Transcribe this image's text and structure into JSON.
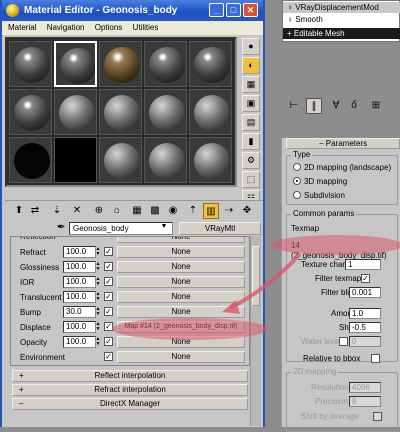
{
  "window": {
    "title": "Material Editor - Geonosis_body"
  },
  "menu": [
    "Material",
    "Navigation",
    "Options",
    "Utilities"
  ],
  "material": {
    "name": "Geonosis_body",
    "type": "VRayMtl"
  },
  "maps": [
    {
      "label": "Refract",
      "amount": "100.0",
      "checked": true,
      "map": "None"
    },
    {
      "label": "Glossiness",
      "amount": "100.0",
      "checked": true,
      "map": "None"
    },
    {
      "label": "IOR",
      "amount": "100.0",
      "checked": true,
      "map": "None"
    },
    {
      "label": "Translucent",
      "amount": "100.0",
      "checked": true,
      "map": "None"
    },
    {
      "label": "Bump",
      "amount": "30.0",
      "checked": true,
      "map": "None"
    },
    {
      "label": "Displace",
      "amount": "100.0",
      "checked": true,
      "map": "Map #14 (2_geonosis_body_disp.tif)"
    },
    {
      "label": "Opacity",
      "amount": "100.0",
      "checked": true,
      "map": "None"
    },
    {
      "label": "Environment",
      "amount": "",
      "checked": true,
      "map": "None"
    }
  ],
  "rollouts": {
    "reflect": "Reflect interpolation",
    "refract": "Refract interpolation",
    "directx": "DirectX Manager"
  },
  "modifier_stack": [
    "VRayDisplacementMod",
    "Smooth",
    "Editable Mesh"
  ],
  "params": {
    "header": "Parameters",
    "type_group": "Type",
    "type_options": [
      "2D mapping (landscape)",
      "3D mapping",
      "Subdivision"
    ],
    "type_selected": "3D mapping",
    "common_group": "Common params",
    "texmap_label": "Texmap",
    "texmap_value": "14 (2_geonosis_body_disp.tif)",
    "texture_chan_label": "Texture chan",
    "texture_chan": "1",
    "filter_texmap_label": "Filter texmap",
    "filter_texmap": true,
    "filter_blur_label": "Filter blur",
    "filter_blur": "0.001",
    "amount_label": "Amount",
    "amount": "1.0",
    "shift_label": "Shift",
    "shift": "-0.5",
    "water_level_label": "Water level",
    "water_level": "0",
    "relative_label": "Relative to bbox",
    "mapping2d_group": "2D mapping",
    "resolution_label": "Resolution",
    "resolution": "4096",
    "precision_label": "Precision",
    "precision": "8",
    "shift_by_avg_label": "Shift by average"
  },
  "annotation_color": "#d85a6e"
}
